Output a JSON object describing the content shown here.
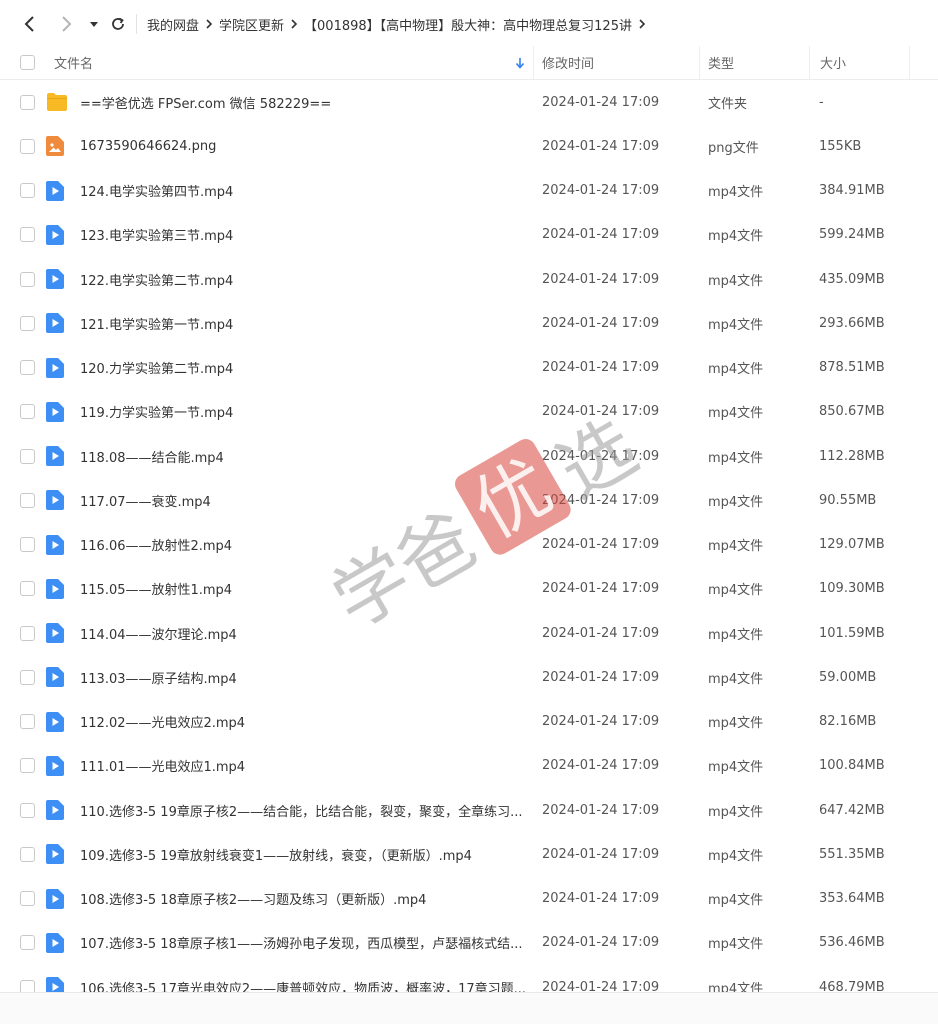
{
  "breadcrumb": [
    "我的网盘",
    "学院区更新",
    "【001898】【高中物理】殷大神：高中物理总复习125讲"
  ],
  "columns": {
    "name": "文件名",
    "modified": "修改时间",
    "type": "类型",
    "size": "大小"
  },
  "files": [
    {
      "name": "==学爸优选 FPSer.com 微信 582229==",
      "time": "2024-01-24 17:09",
      "type": "文件夹",
      "size": "-",
      "icon": "folder-icon"
    },
    {
      "name": "1673590646624.png",
      "time": "2024-01-24 17:09",
      "type": "png文件",
      "size": "155KB",
      "icon": "image-file-icon"
    },
    {
      "name": "124.电学实验第四节.mp4",
      "time": "2024-01-24 17:09",
      "type": "mp4文件",
      "size": "384.91MB",
      "icon": "video-file-icon"
    },
    {
      "name": "123.电学实验第三节.mp4",
      "time": "2024-01-24 17:09",
      "type": "mp4文件",
      "size": "599.24MB",
      "icon": "video-file-icon"
    },
    {
      "name": "122.电学实验第二节.mp4",
      "time": "2024-01-24 17:09",
      "type": "mp4文件",
      "size": "435.09MB",
      "icon": "video-file-icon"
    },
    {
      "name": "121.电学实验第一节.mp4",
      "time": "2024-01-24 17:09",
      "type": "mp4文件",
      "size": "293.66MB",
      "icon": "video-file-icon"
    },
    {
      "name": "120.力学实验第二节.mp4",
      "time": "2024-01-24 17:09",
      "type": "mp4文件",
      "size": "878.51MB",
      "icon": "video-file-icon"
    },
    {
      "name": "119.力学实验第一节.mp4",
      "time": "2024-01-24 17:09",
      "type": "mp4文件",
      "size": "850.67MB",
      "icon": "video-file-icon"
    },
    {
      "name": "118.08——结合能.mp4",
      "time": "2024-01-24 17:09",
      "type": "mp4文件",
      "size": "112.28MB",
      "icon": "video-file-icon"
    },
    {
      "name": "117.07——衰变.mp4",
      "time": "2024-01-24 17:09",
      "type": "mp4文件",
      "size": "90.55MB",
      "icon": "video-file-icon"
    },
    {
      "name": "116.06——放射性2.mp4",
      "time": "2024-01-24 17:09",
      "type": "mp4文件",
      "size": "129.07MB",
      "icon": "video-file-icon"
    },
    {
      "name": "115.05——放射性1.mp4",
      "time": "2024-01-24 17:09",
      "type": "mp4文件",
      "size": "109.30MB",
      "icon": "video-file-icon"
    },
    {
      "name": "114.04——波尔理论.mp4",
      "time": "2024-01-24 17:09",
      "type": "mp4文件",
      "size": "101.59MB",
      "icon": "video-file-icon"
    },
    {
      "name": "113.03——原子结构.mp4",
      "time": "2024-01-24 17:09",
      "type": "mp4文件",
      "size": "59.00MB",
      "icon": "video-file-icon"
    },
    {
      "name": "112.02——光电效应2.mp4",
      "time": "2024-01-24 17:09",
      "type": "mp4文件",
      "size": "82.16MB",
      "icon": "video-file-icon"
    },
    {
      "name": "111.01——光电效应1.mp4",
      "time": "2024-01-24 17:09",
      "type": "mp4文件",
      "size": "100.84MB",
      "icon": "video-file-icon"
    },
    {
      "name": "110.选修3-5 19章原子核2——结合能，比结合能，裂变，聚变，全章练习...",
      "time": "2024-01-24 17:09",
      "type": "mp4文件",
      "size": "647.42MB",
      "icon": "video-file-icon"
    },
    {
      "name": "109.选修3-5 19章放射线衰变1——放射线，衰变，（更新版）.mp4",
      "time": "2024-01-24 17:09",
      "type": "mp4文件",
      "size": "551.35MB",
      "icon": "video-file-icon"
    },
    {
      "name": "108.选修3-5 18章原子核2——习题及练习（更新版）.mp4",
      "time": "2024-01-24 17:09",
      "type": "mp4文件",
      "size": "353.64MB",
      "icon": "video-file-icon"
    },
    {
      "name": "107.选修3-5 18章原子核1——汤姆孙电子发现，西瓜模型，卢瑟福核式结...",
      "time": "2024-01-24 17:09",
      "type": "mp4文件",
      "size": "536.46MB",
      "icon": "video-file-icon"
    },
    {
      "name": "106.选修3-5 17章光电效应2——康普顿效应，物质波，概率波，17章习题...",
      "time": "2024-01-24 17:09",
      "type": "mp4文件",
      "size": "468.79MB",
      "icon": "video-file-icon"
    }
  ],
  "watermark": {
    "left_text": "学爸",
    "stamp_text": "优",
    "right_text": "选"
  },
  "colors": {
    "folder": "#f7b924",
    "video": "#3d8ff5",
    "image": "#f08a3c",
    "sort_arrow": "#2f80ed",
    "watermark_gray": "#9a9a9a",
    "watermark_red": "#d9443b"
  }
}
